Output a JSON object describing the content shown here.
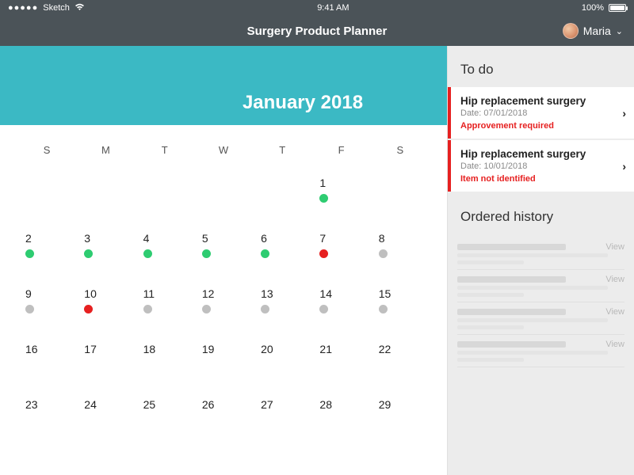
{
  "status_bar": {
    "carrier": "Sketch",
    "time": "9:41 AM",
    "battery_pct": "100%"
  },
  "nav": {
    "title": "Surgery Product Planner",
    "user_name": "Maria"
  },
  "calendar": {
    "title": "January 2018",
    "weekdays": [
      "S",
      "M",
      "T",
      "W",
      "T",
      "F",
      "S"
    ],
    "days": [
      {
        "n": "",
        "dot": ""
      },
      {
        "n": "",
        "dot": ""
      },
      {
        "n": "",
        "dot": ""
      },
      {
        "n": "",
        "dot": ""
      },
      {
        "n": "",
        "dot": ""
      },
      {
        "n": "1",
        "dot": "green"
      },
      {
        "n": "",
        "dot": ""
      },
      {
        "n": "2",
        "dot": "green"
      },
      {
        "n": "3",
        "dot": "green"
      },
      {
        "n": "4",
        "dot": "green"
      },
      {
        "n": "5",
        "dot": "green"
      },
      {
        "n": "6",
        "dot": "green"
      },
      {
        "n": "7",
        "dot": "red"
      },
      {
        "n": "8",
        "dot": "grey"
      },
      {
        "n": "9",
        "dot": "grey"
      },
      {
        "n": "10",
        "dot": "red"
      },
      {
        "n": "11",
        "dot": "grey"
      },
      {
        "n": "12",
        "dot": "grey"
      },
      {
        "n": "13",
        "dot": "grey"
      },
      {
        "n": "14",
        "dot": "grey"
      },
      {
        "n": "15",
        "dot": "grey"
      },
      {
        "n": "16",
        "dot": ""
      },
      {
        "n": "17",
        "dot": ""
      },
      {
        "n": "18",
        "dot": ""
      },
      {
        "n": "19",
        "dot": ""
      },
      {
        "n": "20",
        "dot": ""
      },
      {
        "n": "21",
        "dot": ""
      },
      {
        "n": "22",
        "dot": ""
      },
      {
        "n": "23",
        "dot": ""
      },
      {
        "n": "24",
        "dot": ""
      },
      {
        "n": "25",
        "dot": ""
      },
      {
        "n": "26",
        "dot": ""
      },
      {
        "n": "27",
        "dot": ""
      },
      {
        "n": "28",
        "dot": ""
      },
      {
        "n": "29",
        "dot": ""
      }
    ]
  },
  "sidebar": {
    "todo_title": "To do",
    "todo": [
      {
        "title": "Hip replacement surgery",
        "date": "Date: 07/01/2018",
        "status": "Approvement required"
      },
      {
        "title": "Hip replacement surgery",
        "date": "Date: 10/01/2018",
        "status": "Item not identified"
      }
    ],
    "history_title": "Ordered history",
    "view_label": "View",
    "history_count": 4
  }
}
